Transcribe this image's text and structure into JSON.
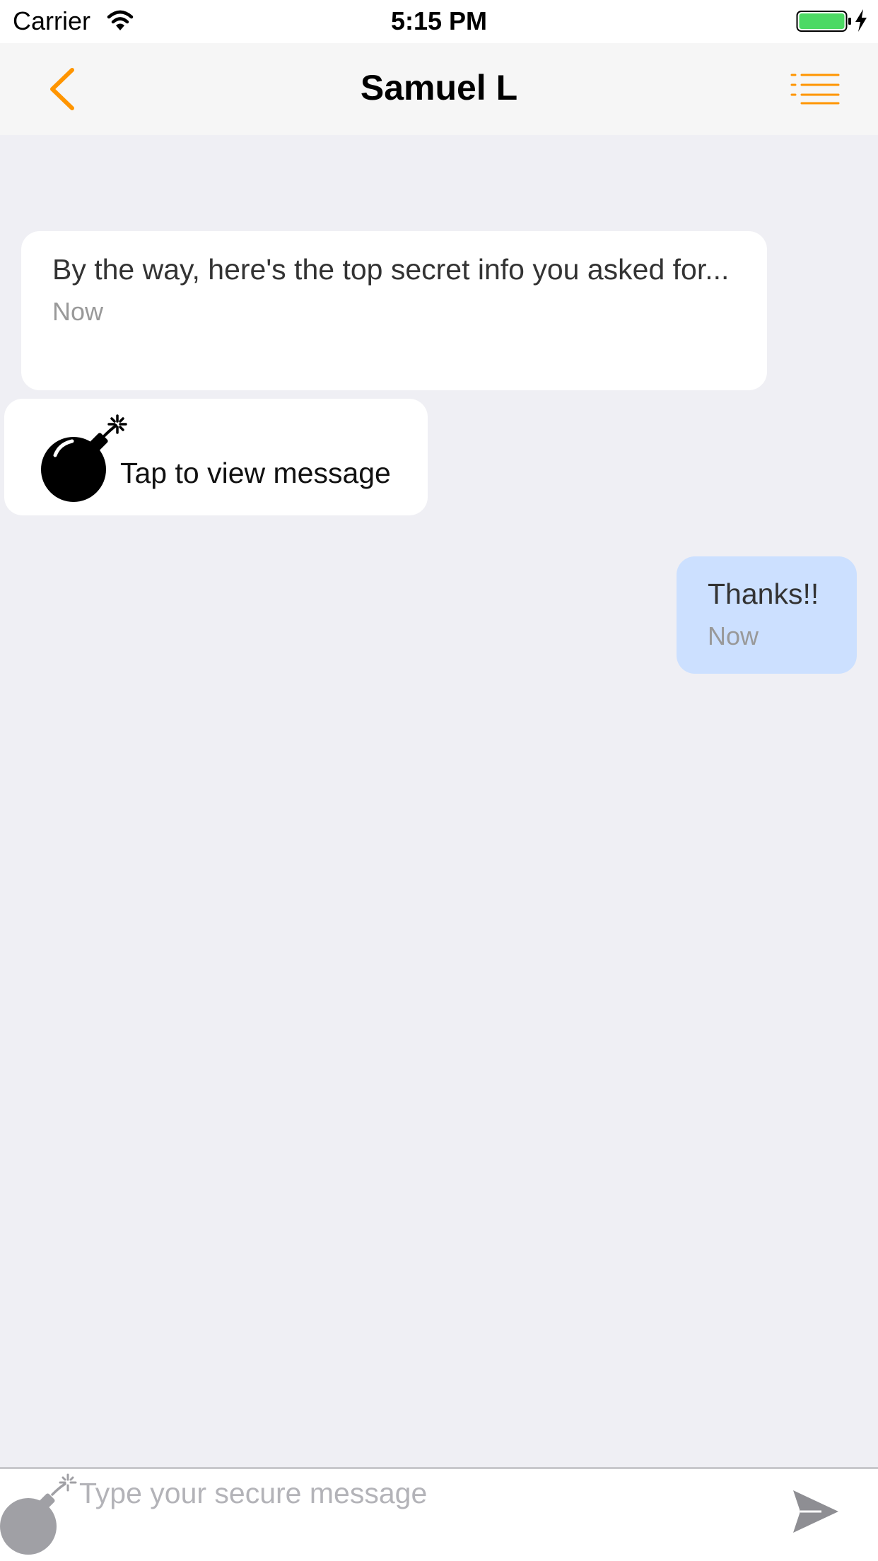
{
  "status_bar": {
    "carrier": "Carrier",
    "time": "5:15 PM"
  },
  "nav": {
    "title": "Samuel L",
    "back_icon": "chevron-left-icon",
    "menu_icon": "list-icon"
  },
  "messages": [
    {
      "direction": "incoming",
      "text": "By the way, here's the top secret info you asked for...",
      "time": "Now"
    },
    {
      "direction": "incoming",
      "type": "secure",
      "icon": "bomb-icon",
      "label": "Tap to view message"
    },
    {
      "direction": "outgoing",
      "text": "Thanks!!",
      "time": "Now"
    }
  ],
  "composer": {
    "placeholder": "Type your secure message",
    "attach_icon": "bomb-icon",
    "send_icon": "send-icon"
  },
  "colors": {
    "accent": "#ff9500",
    "background": "#efeff4",
    "outgoing_bubble": "#cce0ff",
    "incoming_bubble": "#ffffff",
    "battery": "#4cd964"
  }
}
